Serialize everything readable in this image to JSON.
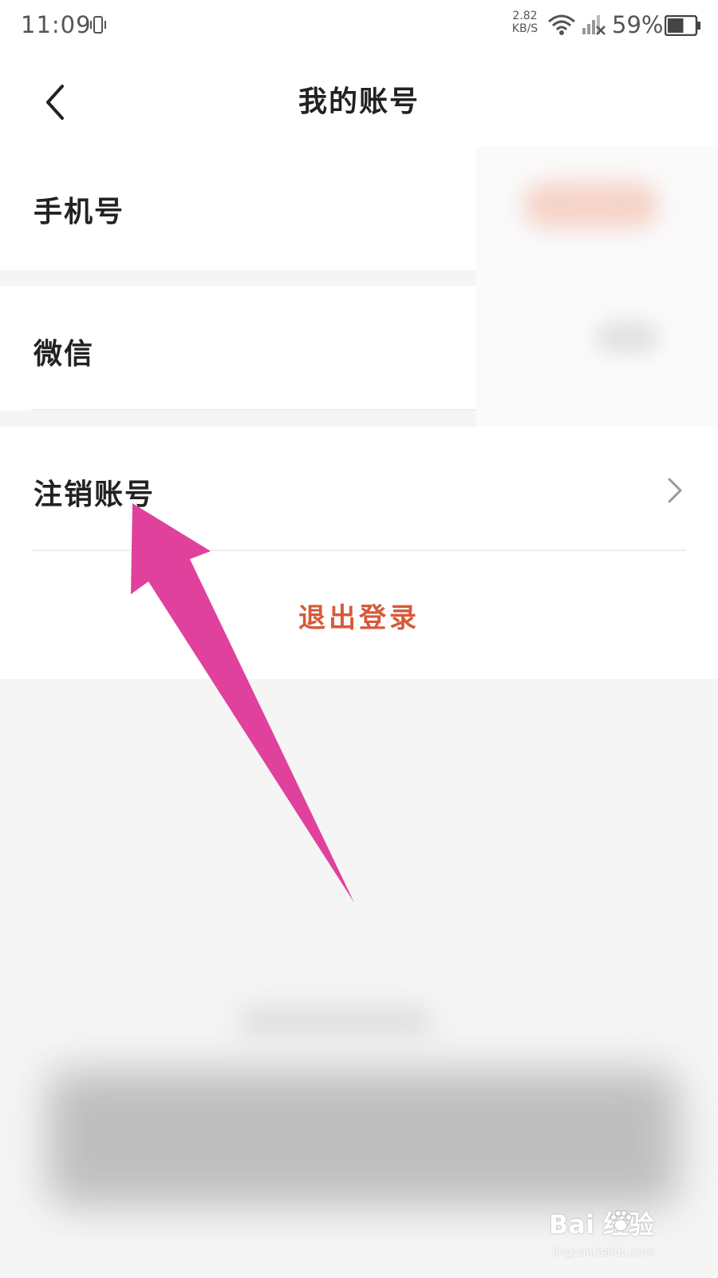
{
  "status_bar": {
    "time": "11:09",
    "speed_value": "2.82",
    "speed_unit": "KB/S",
    "battery_percent": "59%",
    "battery_level": 0.59,
    "icons": [
      "vibrate-icon",
      "wifi-icon",
      "signal-icon",
      "battery-icon"
    ]
  },
  "nav": {
    "title": "我的账号",
    "back_icon": "chevron-left-icon"
  },
  "rows": [
    {
      "label": "手机号"
    },
    {
      "label": "微信"
    },
    {
      "label": "注销账号",
      "icon": "chevron-right-icon"
    }
  ],
  "logout": {
    "label": "退出登录",
    "color": "#d65a3a"
  },
  "annotation": {
    "arrow_color": "#e0419c"
  },
  "watermark": {
    "text": "Bai 经验",
    "sub": "jingyan.baidu.com"
  }
}
